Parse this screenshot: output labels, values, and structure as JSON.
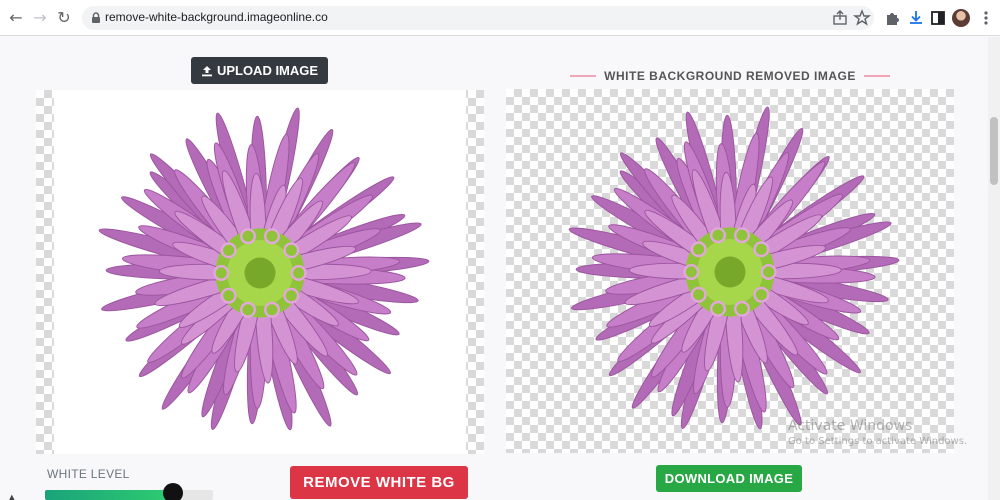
{
  "browser": {
    "url": "remove-white-background.imageonline.co",
    "icons": [
      "back-icon",
      "forward-icon",
      "reload-icon",
      "lock-icon",
      "share-icon",
      "bookmark-star-icon",
      "extensions-icon",
      "download-icon",
      "sidepanel-icon",
      "avatar",
      "menu-icon"
    ]
  },
  "page": {
    "upload_label": "UPLOAD IMAGE",
    "result_title": "WHITE BACKGROUND REMOVED IMAGE",
    "white_level_label": "WHITE LEVEL",
    "white_level_value": 0.76,
    "remove_label": "REMOVE WHITE BG",
    "download_label": "DOWNLOAD IMAGE"
  },
  "watermark": {
    "title": "Activate Windows",
    "subtitle": "Go to Settings to activate Windows."
  },
  "colors": {
    "upload_bg": "#343a40",
    "remove_bg": "#dc3545",
    "download_bg": "#28a745",
    "title_line": "#f2a7b8",
    "petal": "#c77ec9",
    "center": "#9bcc3a"
  }
}
